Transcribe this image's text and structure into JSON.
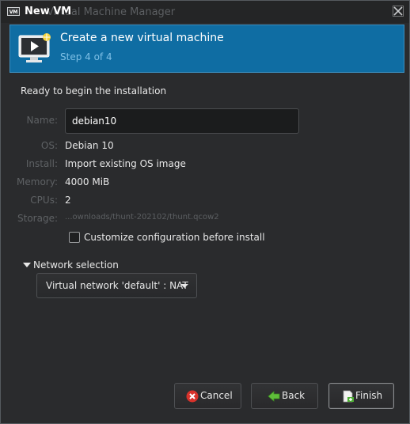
{
  "window": {
    "title": "New VM",
    "background_title": "Virtual Machine Manager"
  },
  "banner": {
    "title": "Create a new virtual machine",
    "subtitle": "Step 4 of 4",
    "color": "#0f6da3"
  },
  "ready_text": "Ready to begin the installation",
  "summary": {
    "name_label": "Name:",
    "name_value": "debian10",
    "os_label": "OS:",
    "os_value": "Debian 10",
    "install_label": "Install:",
    "install_value": "Import existing OS image",
    "memory_label": "Memory:",
    "memory_value": "4000 MiB",
    "cpus_label": "CPUs:",
    "cpus_value": "2",
    "storage_label": "Storage:",
    "storage_value": "...ownloads/thunt-202102/thunt.qcow2"
  },
  "customize": {
    "label": "Customize configuration before install",
    "checked": false
  },
  "network": {
    "expander_label": "Network selection",
    "selected": "Virtual network 'default' : NAT"
  },
  "buttons": {
    "cancel": "Cancel",
    "back": "Back",
    "finish": "Finish"
  },
  "icons": {
    "app": "vm-app-icon",
    "close": "close-icon",
    "banner": "new-vm-monitor-icon",
    "cancel": "cancel-icon",
    "back": "back-arrow-icon",
    "finish": "finish-icon"
  }
}
